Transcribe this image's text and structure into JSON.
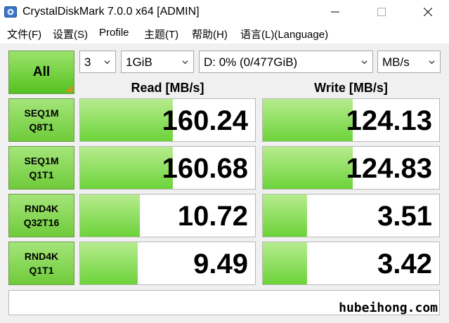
{
  "window": {
    "title": "CrystalDiskMark 7.0.0 x64 [ADMIN]"
  },
  "menu": [
    "文件(F)",
    "设置(S)",
    "Profile",
    "主题(T)",
    "帮助(H)",
    "语言(L)(Language)"
  ],
  "controls": {
    "all_label": "All",
    "count": "3",
    "size": "1GiB",
    "drive": "D: 0% (0/477GiB)",
    "unit": "MB/s"
  },
  "headers": {
    "read": "Read [MB/s]",
    "write": "Write [MB/s]"
  },
  "rows": [
    {
      "line1": "SEQ1M",
      "line2": "Q8T1",
      "read": "160.24",
      "write": "124.13",
      "read_fill": 0.53,
      "write_fill": 0.51
    },
    {
      "line1": "SEQ1M",
      "line2": "Q1T1",
      "read": "160.68",
      "write": "124.83",
      "read_fill": 0.53,
      "write_fill": 0.51
    },
    {
      "line1": "RND4K",
      "line2": "Q32T16",
      "read": "10.72",
      "write": "3.51",
      "read_fill": 0.34,
      "write_fill": 0.25
    },
    {
      "line1": "RND4K",
      "line2": "Q1T1",
      "read": "9.49",
      "write": "3.42",
      "read_fill": 0.33,
      "write_fill": 0.25
    }
  ],
  "comment": "",
  "watermark": "hubeihong.com",
  "colors": {
    "bar_top": "#b7ec8f",
    "bar_bottom": "#6cd33a",
    "button_green": "#55c21f",
    "panel_bg": "#f0f0f0"
  }
}
